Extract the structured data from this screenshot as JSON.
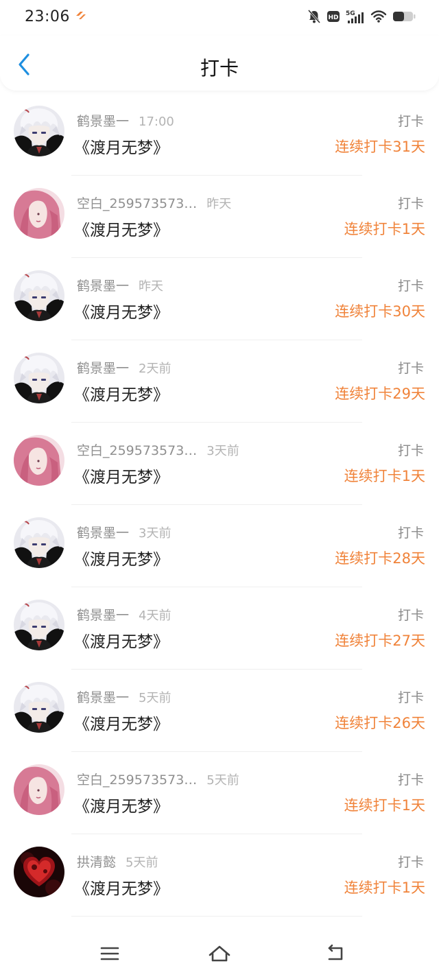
{
  "status_bar": {
    "time": "23:06",
    "icons": [
      "brand-icon",
      "mute-icon",
      "hd-icon",
      "5g-signal-icon",
      "wifi-icon",
      "battery-icon"
    ]
  },
  "header": {
    "title": "打卡",
    "back_icon": "chevron-left-icon"
  },
  "colors": {
    "accent": "#f0833a",
    "back_blue": "#1e8fe0"
  },
  "rows": [
    {
      "name": "鹤景墨一",
      "time": "17:00",
      "book": "《渡月无梦》",
      "type": "打卡",
      "streak": "连续打卡31天",
      "avatar": "white-hair-avatar"
    },
    {
      "name": "空白_259573573…",
      "time": "昨天",
      "book": "《渡月无梦》",
      "type": "打卡",
      "streak": "连续打卡1天",
      "avatar": "pink-hair-avatar"
    },
    {
      "name": "鹤景墨一",
      "time": "昨天",
      "book": "《渡月无梦》",
      "type": "打卡",
      "streak": "连续打卡30天",
      "avatar": "white-hair-avatar"
    },
    {
      "name": "鹤景墨一",
      "time": "2天前",
      "book": "《渡月无梦》",
      "type": "打卡",
      "streak": "连续打卡29天",
      "avatar": "white-hair-avatar"
    },
    {
      "name": "空白_259573573…",
      "time": "3天前",
      "book": "《渡月无梦》",
      "type": "打卡",
      "streak": "连续打卡1天",
      "avatar": "pink-hair-avatar"
    },
    {
      "name": "鹤景墨一",
      "time": "3天前",
      "book": "《渡月无梦》",
      "type": "打卡",
      "streak": "连续打卡28天",
      "avatar": "white-hair-avatar"
    },
    {
      "name": "鹤景墨一",
      "time": "4天前",
      "book": "《渡月无梦》",
      "type": "打卡",
      "streak": "连续打卡27天",
      "avatar": "white-hair-avatar"
    },
    {
      "name": "鹤景墨一",
      "time": "5天前",
      "book": "《渡月无梦》",
      "type": "打卡",
      "streak": "连续打卡26天",
      "avatar": "white-hair-avatar"
    },
    {
      "name": "空白_259573573…",
      "time": "5天前",
      "book": "《渡月无梦》",
      "type": "打卡",
      "streak": "连续打卡1天",
      "avatar": "pink-hair-avatar"
    },
    {
      "name": "拱清懿",
      "time": "5天前",
      "book": "《渡月无梦》",
      "type": "打卡",
      "streak": "连续打卡1天",
      "avatar": "red-heart-avatar"
    }
  ],
  "nav_bar": {
    "icons": [
      "menu-icon",
      "home-icon",
      "back-icon"
    ]
  }
}
